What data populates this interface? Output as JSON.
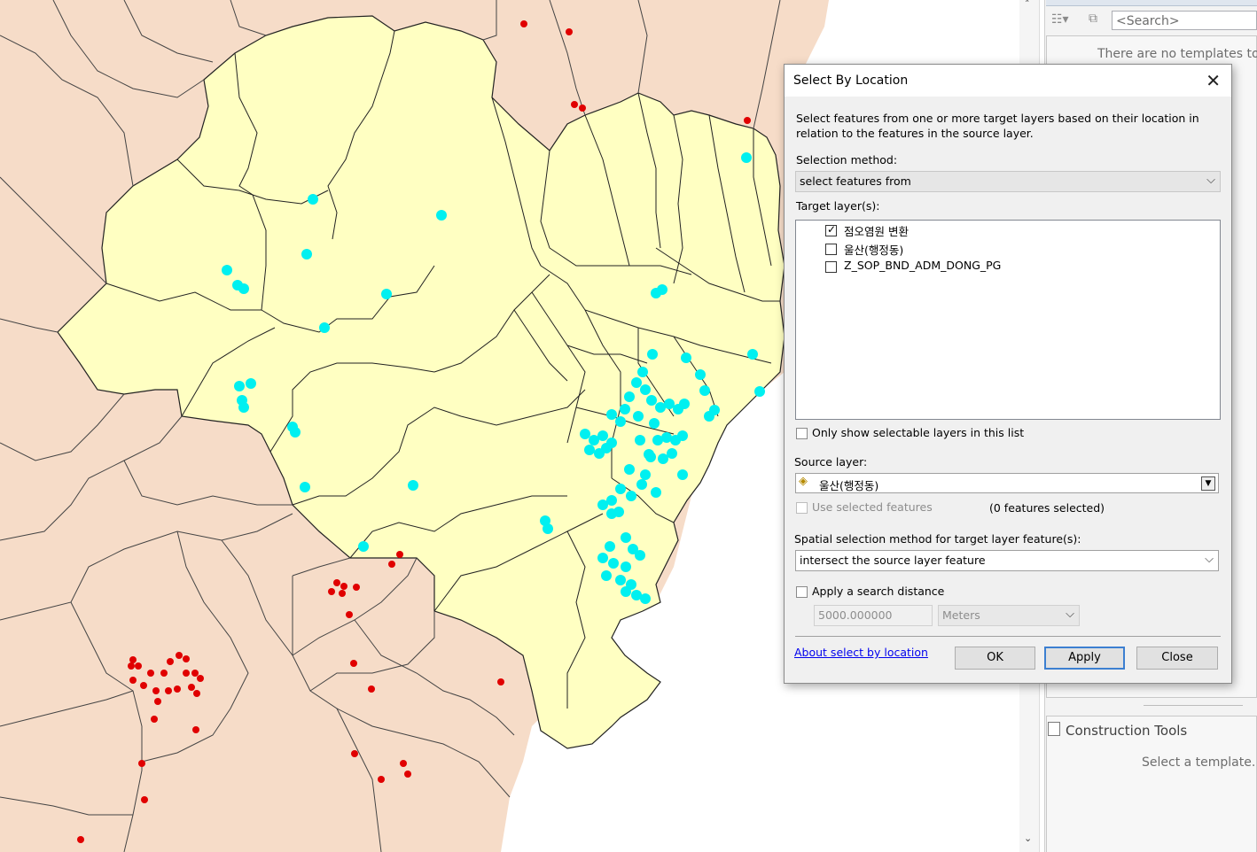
{
  "colors": {
    "background_land": "#f6dcc8",
    "ulsan_fill": "#ffffc2",
    "boundary": "#222222",
    "ulsan_points": "#00f0f0",
    "other_points": "#e00000",
    "sea": "#ffffff",
    "link": "#0000ee",
    "default_button_border": "#3c7fd1"
  },
  "create_features_panel": {
    "search_placeholder": "<Search>",
    "no_templates_text": "There are no templates to s",
    "construction_tools_title": "Construction Tools",
    "select_template_text": "Select a template."
  },
  "dialog": {
    "title": "Select By Location",
    "close_glyph": "✕",
    "description": "Select features from one or more target layers based on their location in relation to the features in the source layer.",
    "selection_method_label": "Selection method:",
    "selection_method_value": "select features from",
    "target_layers_label": "Target layer(s):",
    "target_layers": [
      {
        "name": "점오염원 변환",
        "checked": true
      },
      {
        "name": "울산(행정동)",
        "checked": false
      },
      {
        "name": "Z_SOP_BND_ADM_DONG_PG",
        "checked": false
      }
    ],
    "only_selectable_label": "Only show selectable layers in this list",
    "source_layer_label": "Source layer:",
    "source_layer_value": "울산(행정동)",
    "use_selected_label": "Use selected features",
    "features_selected": "(0 features selected)",
    "spatial_method_label": "Spatial selection method for target layer feature(s):",
    "spatial_method_value": "intersect the source layer feature",
    "search_distance_label": "Apply a search distance",
    "search_distance_value": "5000.000000",
    "distance_unit": "Meters",
    "about_link": "About select by location",
    "ok_label": "OK",
    "apply_label": "Apply",
    "close_label": "Close"
  }
}
